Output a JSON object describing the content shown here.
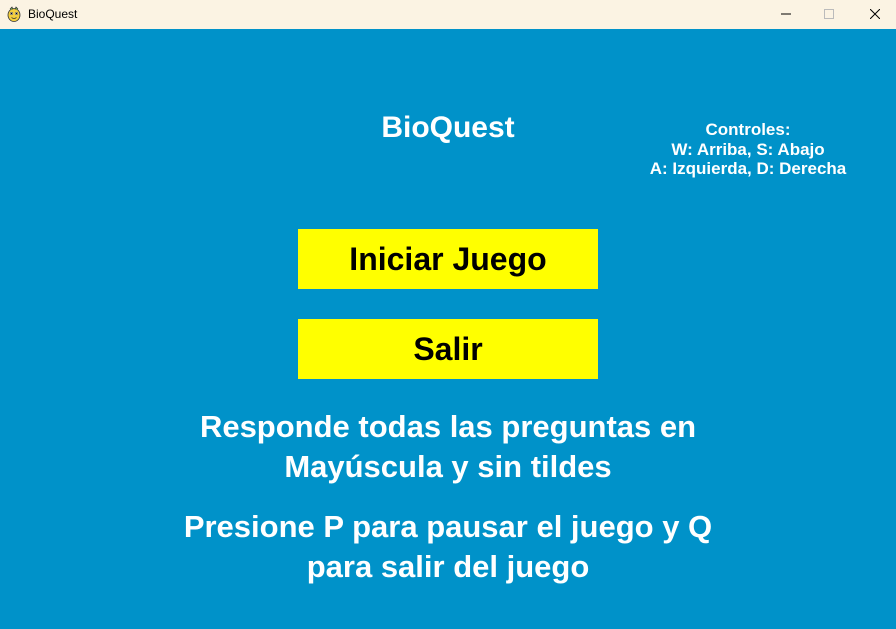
{
  "window": {
    "title": "BioQuest",
    "icons": {
      "app": "pygame-snake-icon",
      "minimize": "minimize-icon",
      "maximize": "maximize-icon",
      "close": "close-icon"
    }
  },
  "game": {
    "title": "BioQuest",
    "controls": {
      "heading": "Controles:",
      "line1": "W: Arriba, S: Abajo",
      "line2": "A: Izquierda, D: Derecha"
    },
    "buttons": {
      "start": "Iniciar Juego",
      "exit": "Salir"
    },
    "instructions": {
      "answer_line1": "Responde todas las preguntas en",
      "answer_line2": "Mayúscula y sin tildes",
      "pause_line1": "Presione P para pausar el juego y Q",
      "pause_line2": "para salir del juego"
    }
  },
  "colors": {
    "background": "#0092c9",
    "button": "#ffff00",
    "titlebar": "#fbf3e3",
    "text": "#ffffff"
  }
}
